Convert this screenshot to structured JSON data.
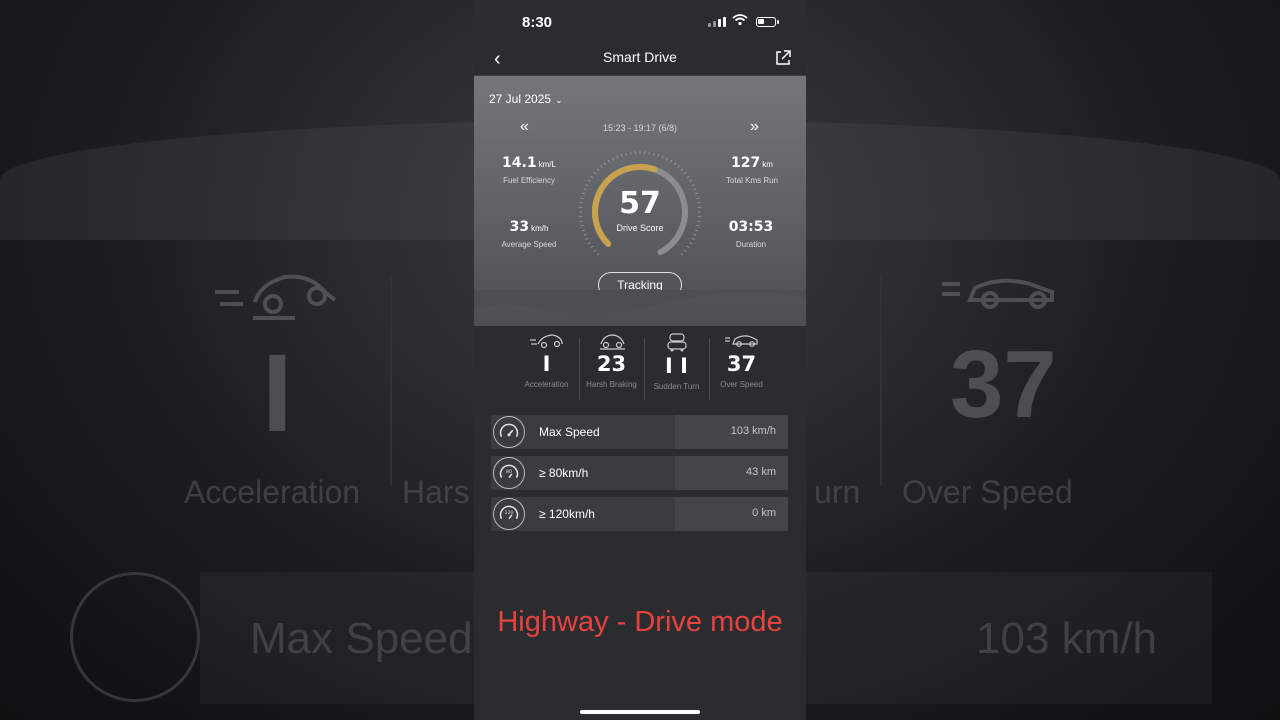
{
  "background": {
    "acceleration_value": "I",
    "acceleration_label": "Acceleration",
    "harsh_label_partial": "Hars",
    "turn_label_partial": "urn",
    "over_speed_value": "37",
    "over_speed_label": "Over Speed",
    "max_speed_label": "Max Speed",
    "max_speed_value": "103 km/h"
  },
  "status": {
    "time": "8:30"
  },
  "nav": {
    "title": "Smart Drive"
  },
  "summary": {
    "date": "27 Jul 2025",
    "time_range": "15:23 - 19:17 (6/8)",
    "fuel_efficiency": {
      "value": "14.1",
      "unit": "km/L",
      "label": "Fuel Efficiency"
    },
    "total_kms": {
      "value": "127",
      "unit": "km",
      "label": "Total Kms Run"
    },
    "average_speed": {
      "value": "33",
      "unit": "km/h",
      "label": "Average Speed"
    },
    "duration": {
      "value": "03:53",
      "label": "Duration"
    },
    "drive_score": {
      "value": "57",
      "label": "Drive Score",
      "max": 100
    },
    "tracking_label": "Tracking"
  },
  "events": [
    {
      "icon": "acceleration-car-icon",
      "value": "I",
      "label": "Acceleration"
    },
    {
      "icon": "harsh-braking-car-icon",
      "value": "23",
      "label": "Harsh Braking"
    },
    {
      "icon": "sudden-turn-car-icon",
      "value": "I I",
      "label": "Sudden Turn"
    },
    {
      "icon": "over-speed-car-icon",
      "value": "37",
      "label": "Over Speed"
    }
  ],
  "speed_rows": [
    {
      "icon": "speedometer-icon",
      "name": "Max Speed",
      "value": "103 km/h"
    },
    {
      "icon": "speedometer-80-icon",
      "name": "≥ 80km/h",
      "value": "43 km"
    },
    {
      "icon": "speedometer-120-icon",
      "name": "≥ 120km/h",
      "value": "0 km"
    }
  ],
  "caption": "Highway - Drive mode",
  "colors": {
    "gauge_fill": "#c8a24e",
    "gauge_track": "#8a8d91",
    "caption": "#e8423f"
  }
}
